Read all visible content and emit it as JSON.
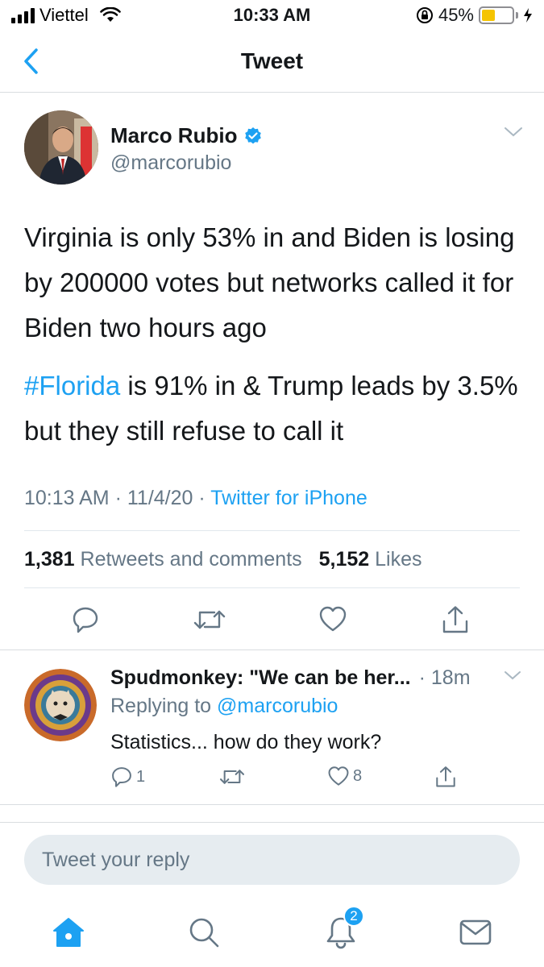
{
  "status_bar": {
    "carrier": "Viettel",
    "time": "10:33 AM",
    "battery_percent": "45%",
    "battery_level": 0.45,
    "battery_color": "#f5c400"
  },
  "nav": {
    "title": "Tweet",
    "back_icon": "chevron-left-icon"
  },
  "tweet": {
    "author_name": "Marco Rubio",
    "author_handle": "@marcorubio",
    "verified": true,
    "paragraph1": "Virginia is only 53% in and Biden is losing by 200000 votes but networks called it for Biden two hours ago",
    "hashtag": "#Florida",
    "paragraph2_rest": " is 91% in & Trump leads by 3.5% but they still refuse to call it",
    "time": "10:13 AM",
    "date": "11/4/20",
    "source": "Twitter for iPhone",
    "retweets_count": "1,381",
    "retweets_label": "Retweets and comments",
    "likes_count": "5,152",
    "likes_label": "Likes"
  },
  "reply": {
    "name": "Spudmonkey: \"We can be her...",
    "time": "· 18m",
    "replying_prefix": "Replying to ",
    "replying_handle": "@marcorubio",
    "text": "Statistics... how do they work?",
    "reply_count": "1",
    "like_count": "8"
  },
  "composer": {
    "placeholder": "Tweet your reply"
  },
  "tab_bar": {
    "notifications_badge": "2"
  },
  "colors": {
    "accent": "#1da1f2",
    "secondary_text": "#657786",
    "text": "#14171a"
  }
}
